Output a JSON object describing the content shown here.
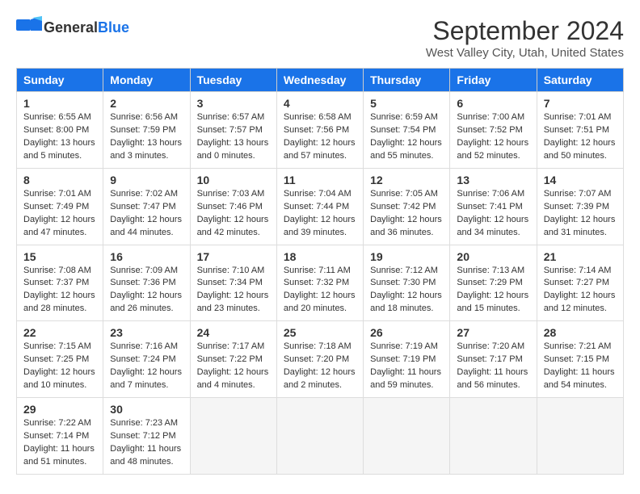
{
  "logo": {
    "general": "General",
    "blue": "Blue"
  },
  "title": "September 2024",
  "location": "West Valley City, Utah, United States",
  "days_of_week": [
    "Sunday",
    "Monday",
    "Tuesday",
    "Wednesday",
    "Thursday",
    "Friday",
    "Saturday"
  ],
  "weeks": [
    [
      {
        "day": "1",
        "info": "Sunrise: 6:55 AM\nSunset: 8:00 PM\nDaylight: 13 hours\nand 5 minutes."
      },
      {
        "day": "2",
        "info": "Sunrise: 6:56 AM\nSunset: 7:59 PM\nDaylight: 13 hours\nand 3 minutes."
      },
      {
        "day": "3",
        "info": "Sunrise: 6:57 AM\nSunset: 7:57 PM\nDaylight: 13 hours\nand 0 minutes."
      },
      {
        "day": "4",
        "info": "Sunrise: 6:58 AM\nSunset: 7:56 PM\nDaylight: 12 hours\nand 57 minutes."
      },
      {
        "day": "5",
        "info": "Sunrise: 6:59 AM\nSunset: 7:54 PM\nDaylight: 12 hours\nand 55 minutes."
      },
      {
        "day": "6",
        "info": "Sunrise: 7:00 AM\nSunset: 7:52 PM\nDaylight: 12 hours\nand 52 minutes."
      },
      {
        "day": "7",
        "info": "Sunrise: 7:01 AM\nSunset: 7:51 PM\nDaylight: 12 hours\nand 50 minutes."
      }
    ],
    [
      {
        "day": "8",
        "info": "Sunrise: 7:01 AM\nSunset: 7:49 PM\nDaylight: 12 hours\nand 47 minutes."
      },
      {
        "day": "9",
        "info": "Sunrise: 7:02 AM\nSunset: 7:47 PM\nDaylight: 12 hours\nand 44 minutes."
      },
      {
        "day": "10",
        "info": "Sunrise: 7:03 AM\nSunset: 7:46 PM\nDaylight: 12 hours\nand 42 minutes."
      },
      {
        "day": "11",
        "info": "Sunrise: 7:04 AM\nSunset: 7:44 PM\nDaylight: 12 hours\nand 39 minutes."
      },
      {
        "day": "12",
        "info": "Sunrise: 7:05 AM\nSunset: 7:42 PM\nDaylight: 12 hours\nand 36 minutes."
      },
      {
        "day": "13",
        "info": "Sunrise: 7:06 AM\nSunset: 7:41 PM\nDaylight: 12 hours\nand 34 minutes."
      },
      {
        "day": "14",
        "info": "Sunrise: 7:07 AM\nSunset: 7:39 PM\nDaylight: 12 hours\nand 31 minutes."
      }
    ],
    [
      {
        "day": "15",
        "info": "Sunrise: 7:08 AM\nSunset: 7:37 PM\nDaylight: 12 hours\nand 28 minutes."
      },
      {
        "day": "16",
        "info": "Sunrise: 7:09 AM\nSunset: 7:36 PM\nDaylight: 12 hours\nand 26 minutes."
      },
      {
        "day": "17",
        "info": "Sunrise: 7:10 AM\nSunset: 7:34 PM\nDaylight: 12 hours\nand 23 minutes."
      },
      {
        "day": "18",
        "info": "Sunrise: 7:11 AM\nSunset: 7:32 PM\nDaylight: 12 hours\nand 20 minutes."
      },
      {
        "day": "19",
        "info": "Sunrise: 7:12 AM\nSunset: 7:30 PM\nDaylight: 12 hours\nand 18 minutes."
      },
      {
        "day": "20",
        "info": "Sunrise: 7:13 AM\nSunset: 7:29 PM\nDaylight: 12 hours\nand 15 minutes."
      },
      {
        "day": "21",
        "info": "Sunrise: 7:14 AM\nSunset: 7:27 PM\nDaylight: 12 hours\nand 12 minutes."
      }
    ],
    [
      {
        "day": "22",
        "info": "Sunrise: 7:15 AM\nSunset: 7:25 PM\nDaylight: 12 hours\nand 10 minutes."
      },
      {
        "day": "23",
        "info": "Sunrise: 7:16 AM\nSunset: 7:24 PM\nDaylight: 12 hours\nand 7 minutes."
      },
      {
        "day": "24",
        "info": "Sunrise: 7:17 AM\nSunset: 7:22 PM\nDaylight: 12 hours\nand 4 minutes."
      },
      {
        "day": "25",
        "info": "Sunrise: 7:18 AM\nSunset: 7:20 PM\nDaylight: 12 hours\nand 2 minutes."
      },
      {
        "day": "26",
        "info": "Sunrise: 7:19 AM\nSunset: 7:19 PM\nDaylight: 11 hours\nand 59 minutes."
      },
      {
        "day": "27",
        "info": "Sunrise: 7:20 AM\nSunset: 7:17 PM\nDaylight: 11 hours\nand 56 minutes."
      },
      {
        "day": "28",
        "info": "Sunrise: 7:21 AM\nSunset: 7:15 PM\nDaylight: 11 hours\nand 54 minutes."
      }
    ],
    [
      {
        "day": "29",
        "info": "Sunrise: 7:22 AM\nSunset: 7:14 PM\nDaylight: 11 hours\nand 51 minutes."
      },
      {
        "day": "30",
        "info": "Sunrise: 7:23 AM\nSunset: 7:12 PM\nDaylight: 11 hours\nand 48 minutes."
      },
      {
        "day": "",
        "info": ""
      },
      {
        "day": "",
        "info": ""
      },
      {
        "day": "",
        "info": ""
      },
      {
        "day": "",
        "info": ""
      },
      {
        "day": "",
        "info": ""
      }
    ]
  ]
}
